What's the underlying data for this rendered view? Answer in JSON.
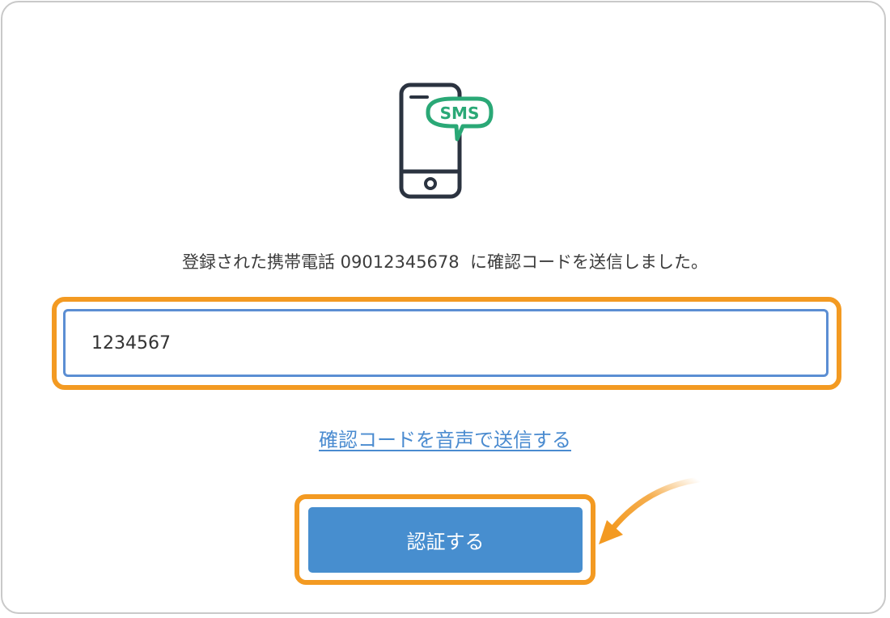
{
  "message": {
    "prefix": "登録された携帯電話 ",
    "phone": "09012345678",
    "suffix": "  に確認コードを送信しました。"
  },
  "icon": {
    "name": "phone-sms-icon",
    "bubble_text": "SMS",
    "phone_color": "#2b3340",
    "bubble_color": "#2aa876"
  },
  "code_input": {
    "value": "1234567"
  },
  "voice_link": {
    "label": "確認コードを音声で送信する"
  },
  "verify_button": {
    "label": "認証する"
  },
  "colors": {
    "highlight": "#f39a22",
    "button": "#478ecf",
    "link": "#4a8bd0",
    "input_border": "#5b8ed3"
  }
}
